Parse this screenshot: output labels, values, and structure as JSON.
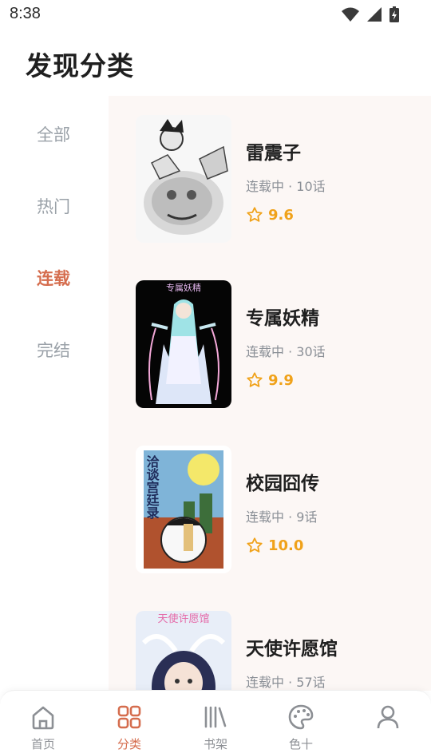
{
  "status": {
    "time": "8:38"
  },
  "page": {
    "title": "发现分类"
  },
  "sidebar": {
    "items": [
      {
        "label": "全部"
      },
      {
        "label": "热门"
      },
      {
        "label": "连载"
      },
      {
        "label": "完结"
      }
    ]
  },
  "comics": [
    {
      "title": "雷震子",
      "meta": "连载中 · 10话",
      "rating": "9.6"
    },
    {
      "title": "专属妖精",
      "meta": "连载中 · 30话",
      "rating": "9.9",
      "cover_text": "专属妖精"
    },
    {
      "title": "校园囧传",
      "meta": "连载中 · 9话",
      "rating": "10.0",
      "cover_text": "洽谈宫廷录"
    },
    {
      "title": "天使许愿馆",
      "meta": "连载中 · 57话",
      "rating": "",
      "cover_text": "天使许愿馆"
    }
  ],
  "tabbar": {
    "items": [
      {
        "label": "首页",
        "icon": "home-icon"
      },
      {
        "label": "分类",
        "icon": "grid-icon"
      },
      {
        "label": "书架",
        "icon": "bookshelf-icon"
      },
      {
        "label": "色十",
        "icon": "palette-icon"
      },
      {
        "label": "",
        "icon": "user-icon"
      }
    ]
  },
  "colors": {
    "accent": "#d56d4e",
    "rating": "#f0a21a",
    "content_bg": "#fcf7f5"
  }
}
